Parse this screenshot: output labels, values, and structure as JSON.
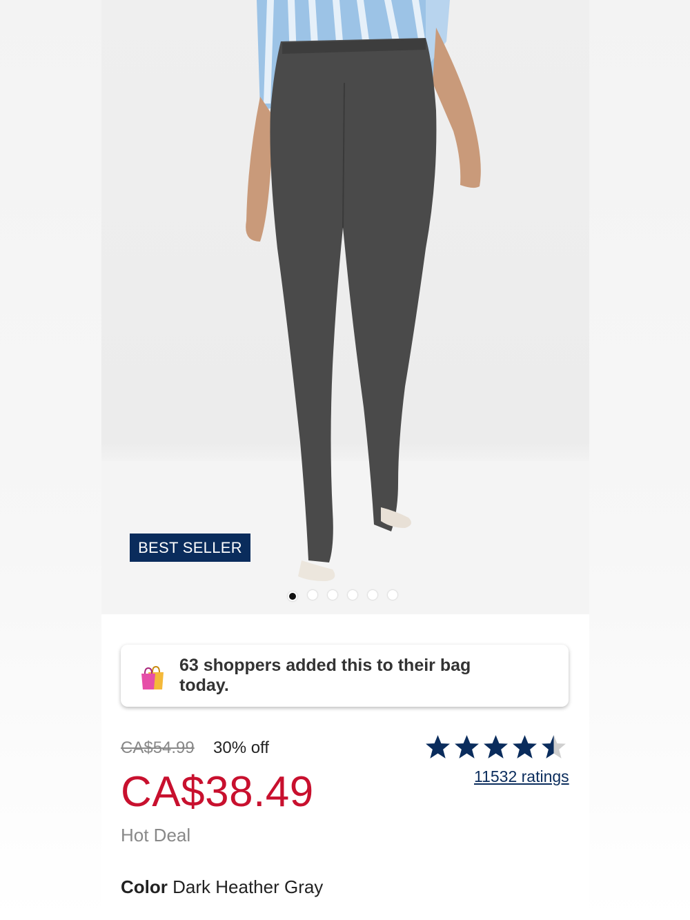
{
  "product": {
    "badge": "BEST SELLER",
    "carousel": {
      "count": 6,
      "active_index": 0
    },
    "social_proof": "63 shoppers added this to their bag today.",
    "original_price": "CA$54.99",
    "discount": "30% off",
    "sale_price": "CA$38.49",
    "deal_label": "Hot Deal",
    "rating": {
      "value": 4.5,
      "max": 5,
      "count_text": "11532 ratings"
    },
    "color_label": "Color",
    "color_value": "Dark Heather Gray"
  },
  "icons": {
    "social_proof": "shopping-bags-icon",
    "rating": "star-icon"
  },
  "colors": {
    "price_red": "#c8102e",
    "navy": "#0a2c5c",
    "star": "#0a2c5c"
  }
}
